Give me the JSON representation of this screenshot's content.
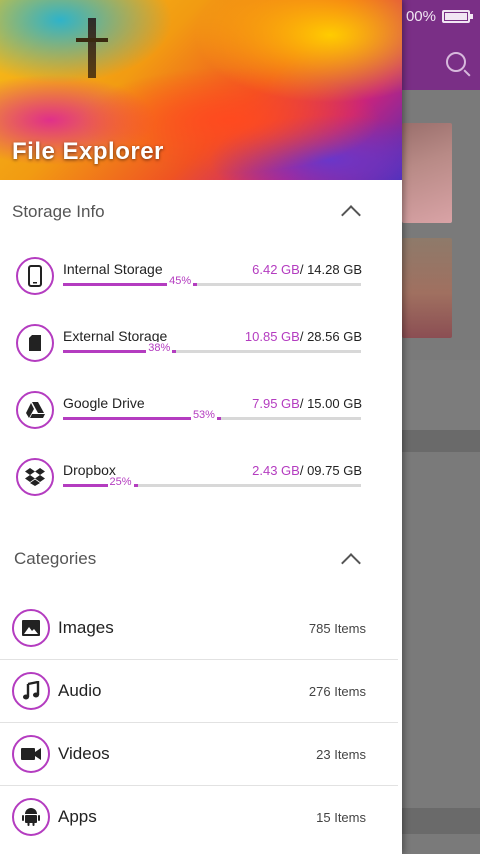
{
  "status_bar": {
    "battery_text": "00%"
  },
  "drawer": {
    "title": "File Explorer",
    "storage_section": {
      "title": "Storage Info",
      "items": [
        {
          "name": "Internal Storage",
          "used": "6.42 GB",
          "total": "/ 14.28 GB",
          "percent_label": "45%",
          "percent": 45,
          "icon": "smartphone-icon"
        },
        {
          "name": "External Storage",
          "used": "10.85 GB",
          "total": "/ 28.56 GB",
          "percent_label": "38%",
          "percent": 38,
          "icon": "sd-card-icon"
        },
        {
          "name": "Google Drive",
          "used": "7.95 GB",
          "total": "/ 15.00 GB",
          "percent_label": "53%",
          "percent": 53,
          "icon": "google-drive-icon"
        },
        {
          "name": "Dropbox",
          "used": "2.43 GB",
          "total": "/ 09.75 GB",
          "percent_label": "25%",
          "percent": 25,
          "icon": "dropbox-icon"
        }
      ]
    },
    "categories_section": {
      "title": "Categories",
      "items": [
        {
          "label": "Images",
          "count": "785 Items",
          "icon": "image-icon"
        },
        {
          "label": "Audio",
          "count": "276 Items",
          "icon": "music-note-icon"
        },
        {
          "label": "Videos",
          "count": "23 Items",
          "icon": "video-camera-icon"
        },
        {
          "label": "Apps",
          "count": "15 Items",
          "icon": "android-icon"
        }
      ]
    }
  },
  "colors": {
    "accent": "#b43cc0",
    "topbar": "#7a2f86"
  }
}
